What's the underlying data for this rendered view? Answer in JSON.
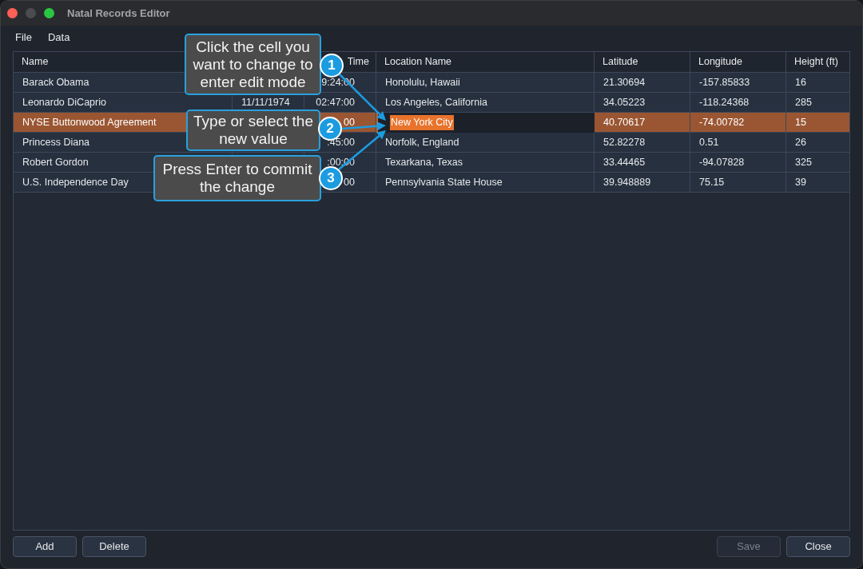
{
  "window": {
    "title": "Natal Records Editor"
  },
  "menu": [
    "File",
    "Data"
  ],
  "table": {
    "headers": {
      "name": "Name",
      "column_3": "Time",
      "location_name": "Location Name",
      "latitude": "Latitude",
      "longitude": "Longitude",
      "height_ft": "Height (ft)"
    },
    "rows": [
      {
        "name": "Barack Obama",
        "column_3": "9:24:00",
        "location_name": "Honolulu, Hawaii",
        "latitude": "21.30694",
        "longitude": "-157.85833",
        "height_ft": "16",
        "selected": false,
        "editing": false
      },
      {
        "name": "Leonardo DiCaprio",
        "column_2": "11/11/1974",
        "column_3": "02:47:00",
        "location_name": "Los Angeles, California",
        "latitude": "34.05223",
        "longitude": "-118.24368",
        "height_ft": "285",
        "selected": false,
        "editing": false
      },
      {
        "name": "NYSE Buttonwood Agreement",
        "column_3": "00",
        "location_name": "New York City",
        "latitude": "40.70617",
        "longitude": "-74.00782",
        "height_ft": "15",
        "selected": true,
        "editing": true
      },
      {
        "name": "Princess Diana",
        "column_3": ":45:00",
        "location_name": "Norfolk, England",
        "latitude": "52.82278",
        "longitude": "0.51",
        "height_ft": "26",
        "selected": false,
        "editing": false
      },
      {
        "name": "Robert Gordon",
        "column_3": ":00:00",
        "location_name": "Texarkana, Texas",
        "latitude": "33.44465",
        "longitude": "-94.07828",
        "height_ft": "325",
        "selected": false,
        "editing": false
      },
      {
        "name": "U.S. Independence Day",
        "column_3": "00",
        "location_name": "Pennsylvania State House",
        "latitude": "39.948889",
        "longitude": "75.15",
        "height_ft": "39",
        "selected": false,
        "editing": false
      }
    ]
  },
  "buttons": [
    {
      "label": "Add",
      "disabled": false
    },
    {
      "label": "Delete",
      "disabled": false
    },
    {
      "label": "Save",
      "disabled": true
    },
    {
      "label": "Close",
      "disabled": false
    }
  ],
  "callouts": [
    {
      "number": "1",
      "text": "Click the cell you\nwant to change to\nenter edit mode"
    },
    {
      "number": "2",
      "text": "Type or select the\nnew value"
    },
    {
      "number": "3",
      "text": "Press Enter to commit\nthe change"
    }
  ]
}
